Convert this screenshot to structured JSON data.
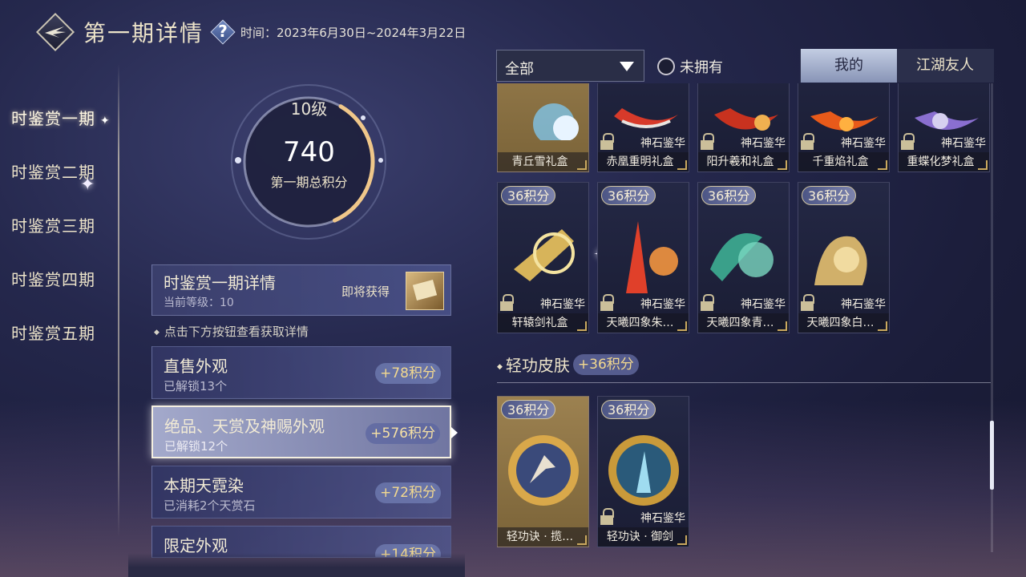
{
  "header": {
    "title": "第一期详情",
    "help_icon": "?",
    "period": "时间：2023年6月30日~2024年3月22日"
  },
  "nav": {
    "items": [
      {
        "label": "时鉴赏一期",
        "active": true
      },
      {
        "label": "时鉴赏二期",
        "active": false
      },
      {
        "label": "时鉴赏三期",
        "active": false
      },
      {
        "label": "时鉴赏四期",
        "active": false
      },
      {
        "label": "时鉴赏五期",
        "active": false
      }
    ]
  },
  "score": {
    "level": "10级",
    "points": "740",
    "label": "第一期总积分",
    "progress": 0.35
  },
  "detail": {
    "title": "时鉴赏一期详情",
    "current_level": "当前等级：10",
    "upcoming": "即将获得",
    "hint": "点击下方按钮查看获取详情"
  },
  "categories": [
    {
      "name": "直售外观",
      "sub": "已解锁13个",
      "points": "+78积分",
      "selected": false
    },
    {
      "name": "绝品、天赏及神赐外观",
      "sub": "已解锁12个",
      "points": "+576积分",
      "selected": true
    },
    {
      "name": "本期天霓染",
      "sub": "已消耗2个天赏石",
      "points": "+72积分",
      "selected": false
    },
    {
      "name": "限定外观",
      "sub": "",
      "points": "+14积分",
      "selected": false
    }
  ],
  "toolbar": {
    "filter": "全部",
    "unowned": "未拥有",
    "tabs": [
      "我的",
      "江湖友人"
    ]
  },
  "items_row1": [
    {
      "name": "青丘雪礼盒",
      "source": "",
      "gold": true,
      "locked": false,
      "colors": [
        "#7fd0ff",
        "#e8d8b0"
      ]
    },
    {
      "name": "赤凰重明礼盒",
      "source": "神石鉴华",
      "gold": false,
      "locked": true,
      "colors": [
        "#d73a2a",
        "#e9e4e0"
      ]
    },
    {
      "name": "阳升羲和礼盒",
      "source": "神石鉴华",
      "gold": false,
      "locked": true,
      "colors": [
        "#c8321f",
        "#f0b050"
      ]
    },
    {
      "name": "千重焰礼盒",
      "source": "神石鉴华",
      "gold": false,
      "locked": true,
      "colors": [
        "#e85a1a",
        "#ffb040"
      ]
    },
    {
      "name": "重蝶化梦礼盒",
      "source": "神石鉴华",
      "gold": false,
      "locked": true,
      "colors": [
        "#8a6fd0",
        "#d6d0f0"
      ]
    }
  ],
  "items_row2": [
    {
      "name": "轩辕剑礼盒",
      "points": "36积分",
      "source": "神石鉴华",
      "colors": [
        "#d7b45a",
        "#f4e3a0"
      ]
    },
    {
      "name": "天曦四象朱…",
      "points": "36积分",
      "source": "神石鉴华",
      "colors": [
        "#e0402a",
        "#ff9b40"
      ]
    },
    {
      "name": "天曦四象青…",
      "points": "36积分",
      "source": "神石鉴华",
      "colors": [
        "#3aa08a",
        "#7ad8c0"
      ]
    },
    {
      "name": "天曦四象白…",
      "points": "36积分",
      "source": "神石鉴华",
      "colors": [
        "#d1b06a",
        "#f1dba0"
      ]
    }
  ],
  "section": {
    "title": "轻功皮肤",
    "points": "+36积分"
  },
  "items_row3": [
    {
      "name": "轻功诀 · 揽…",
      "points": "36积分",
      "source": "",
      "gold": true,
      "locked": false,
      "colors": [
        "#d9a84a",
        "#3a4a7a"
      ]
    },
    {
      "name": "轻功诀 · 御剑",
      "points": "36积分",
      "source": "神石鉴华",
      "gold": false,
      "locked": true,
      "colors": [
        "#c99a3a",
        "#2a5a7a"
      ]
    }
  ]
}
